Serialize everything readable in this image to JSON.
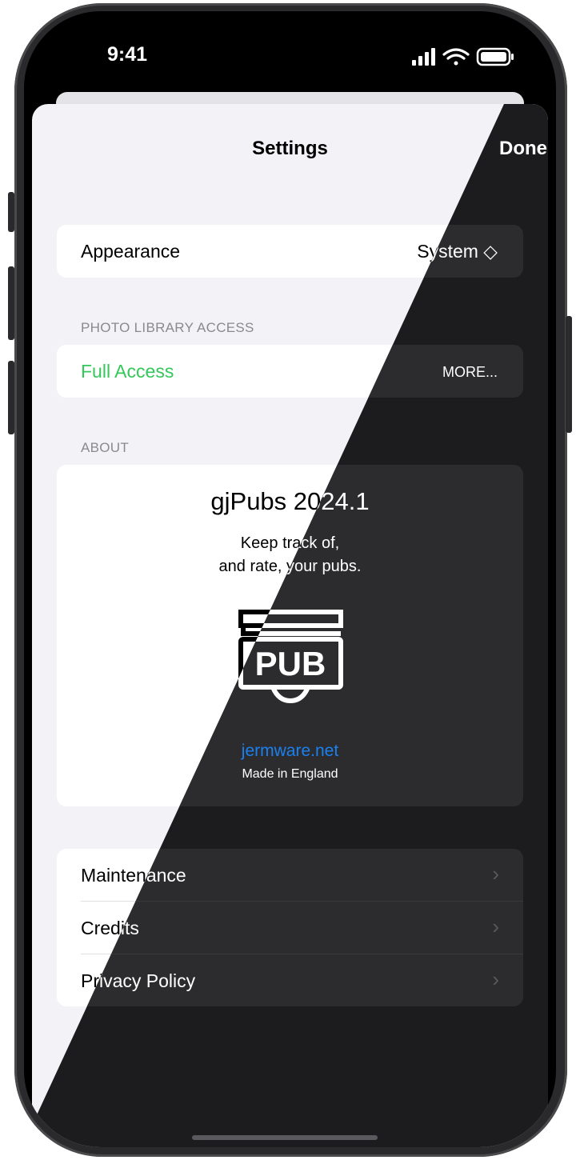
{
  "status_bar": {
    "time": "9:41"
  },
  "nav": {
    "title": "Settings",
    "done": "Done"
  },
  "appearance": {
    "label": "Appearance",
    "value": "System ◇"
  },
  "photo_access": {
    "header": "PHOTO LIBRARY ACCESS",
    "status": "Full Access",
    "more": "MORE..."
  },
  "about": {
    "header": "ABOUT",
    "app_title": "gjPubs 2024.1",
    "tagline_line1": "Keep track of,",
    "tagline_line2": "and rate, your pubs.",
    "logo_text": "PUB",
    "link": "jermware.net",
    "made_in": "Made in England"
  },
  "menu": [
    {
      "label": "Maintenance"
    },
    {
      "label": "Credits"
    },
    {
      "label": "Privacy Policy"
    }
  ],
  "colors": {
    "accent_green": "#34c759",
    "link_blue": "#1b80f0",
    "light_bg": "#f2f2f7",
    "dark_bg": "#1c1c1e"
  }
}
